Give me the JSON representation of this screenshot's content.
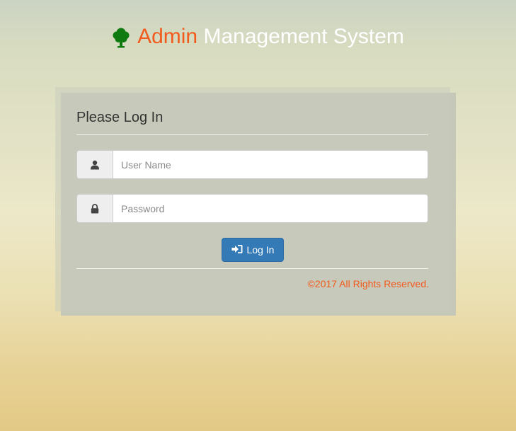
{
  "header": {
    "brand_icon": "tree-icon",
    "title_highlight": "Admin",
    "title_rest": "Management System",
    "colors": {
      "highlight": "#f25a1e",
      "rest": "#ffffff",
      "icon": "#0f7a0f"
    }
  },
  "login": {
    "title": "Please Log In",
    "username": {
      "icon": "user-icon",
      "placeholder": "User Name",
      "value": ""
    },
    "password": {
      "icon": "lock-icon",
      "placeholder": "Password",
      "value": ""
    },
    "submit": {
      "icon": "log-in-icon",
      "label": "Log In",
      "color": "#337ab7"
    },
    "footer": "©2017 All Rights Reserved."
  }
}
